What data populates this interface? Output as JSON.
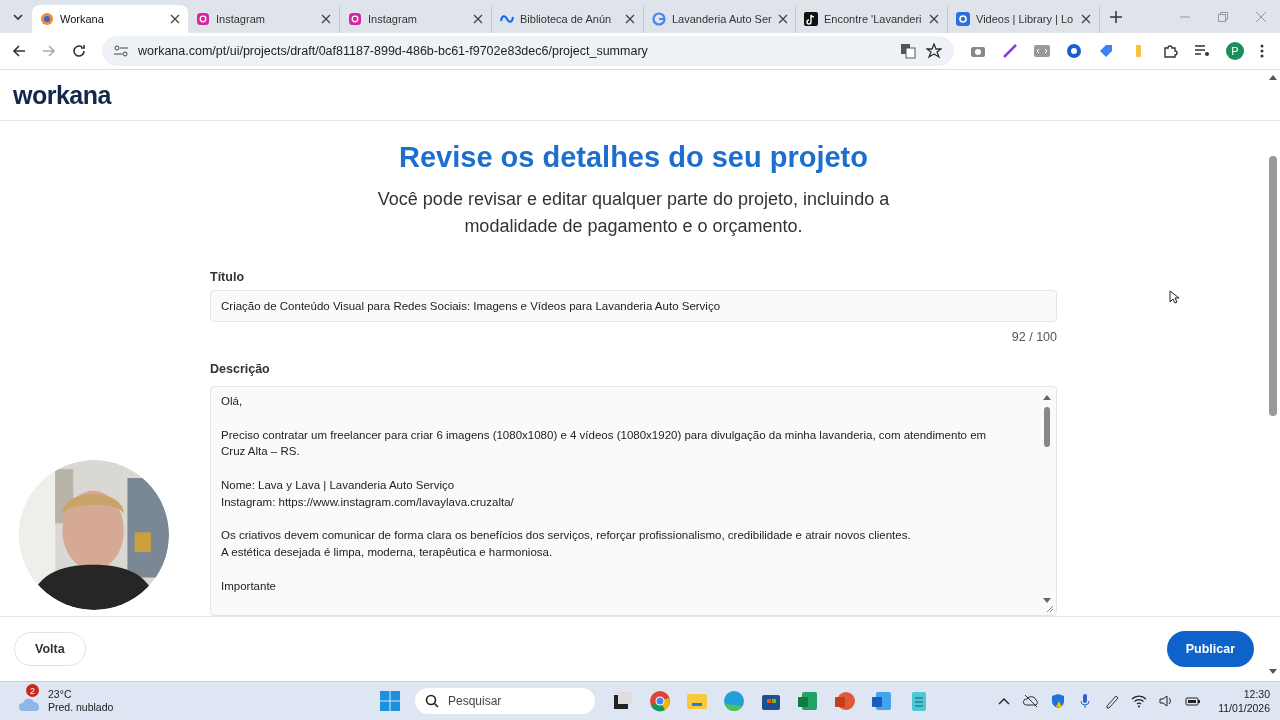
{
  "browser": {
    "tabs": [
      {
        "kind": "workana",
        "label": "Workana",
        "selected": true
      },
      {
        "kind": "instagram",
        "label": "Instagram",
        "selected": false
      },
      {
        "kind": "instagram",
        "label": "Instagram",
        "selected": false
      },
      {
        "kind": "meta",
        "label": "Biblioteca de Anún",
        "selected": false
      },
      {
        "kind": "google",
        "label": "Lavanderia Auto Ser",
        "selected": false
      },
      {
        "kind": "tiktok",
        "label": "Encontre 'Lavanderi",
        "selected": false
      },
      {
        "kind": "gear",
        "label": "Videos | Library | Lo",
        "selected": false
      }
    ],
    "url": "workana.com/pt/ui/projects/draft/0af81187-899d-486b-bc61-f9702e83dec6/project_summary",
    "profile_initial": "P"
  },
  "page": {
    "logo": "workana",
    "heading": "Revise os detalhes do seu projeto",
    "subheading": "Você pode revisar e editar qualquer parte do projeto, incluindo a modalidade de pagamento e o orçamento.",
    "title_label": "Título",
    "title_value": "Criação de Conteúdo Visual para Redes Sociais: Imagens e Vídeos para Lavanderia Auto Serviço",
    "title_counter": "92 / 100",
    "description_label": "Descrição",
    "description": [
      "Olá,",
      "Preciso contratar um freelancer para criar 6 imagens (1080x1080) e 4 vídeos (1080x1920) para divulgação da minha lavanderia, com atendimento em Cruz Alta – RS.",
      "Nome: Lava y Lava | Lavanderia Auto Serviço\nInstagram: https://www.instagram.com/lavaylava.cruzalta/",
      "Os criativos devem comunicar de forma clara os benefícios dos serviços, reforçar profissionalismo, credibilidade e atrair novos clientes.\nA estética desejada é limpa, moderna, terapêutica e harmoniosa.",
      "Importante"
    ],
    "back_button": "Volta",
    "publish_button": "Publicar"
  },
  "taskbar": {
    "weather_badge": "2",
    "temperature": "23°C",
    "weather": "Pred. nublado",
    "search_placeholder": "Pesquisar",
    "time": "12:30",
    "date": "11/01/2026"
  }
}
